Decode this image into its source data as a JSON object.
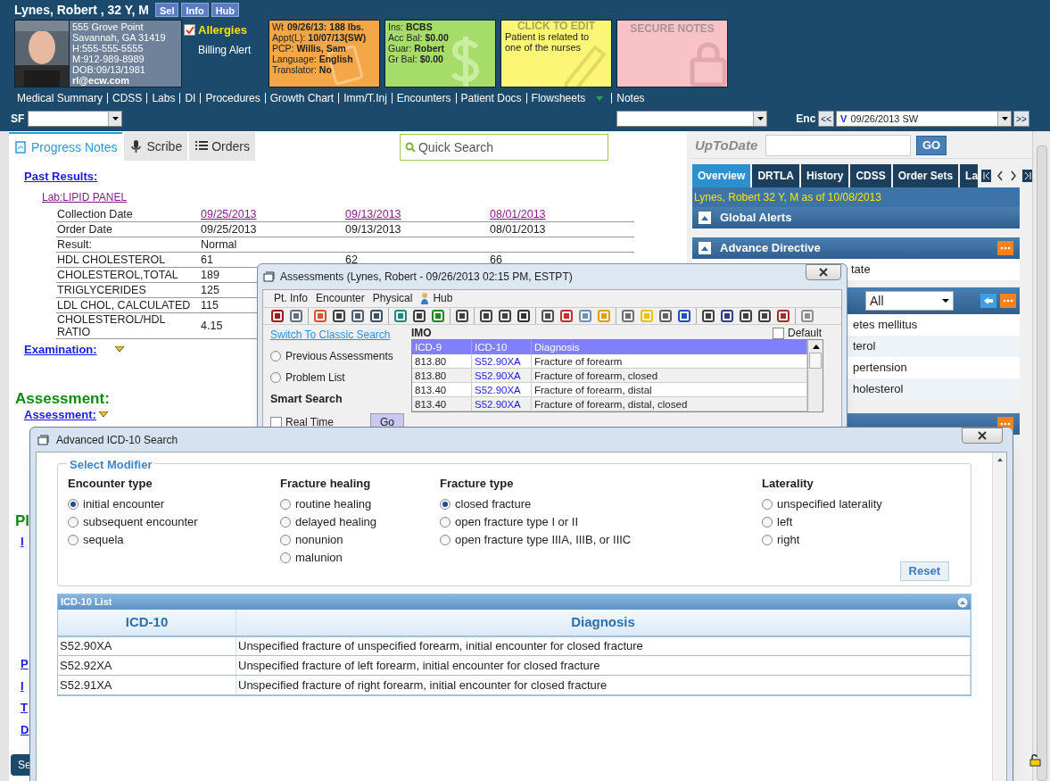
{
  "patient_header": {
    "name": "Lynes, Robert , 32 Y, M",
    "buttons": [
      "Sel",
      "Info",
      "Hub"
    ],
    "address_lines": [
      "555 Grove Point",
      "Savannah, GA 31419",
      "H:555-555-5555",
      "M:912-989-8989",
      "DOB:09/13/1981",
      "rl@ecw.com"
    ],
    "allergies": {
      "label": "Allergies",
      "checked": true
    },
    "billing_alert": "Billing Alert",
    "visit_card": [
      {
        "label": "Wt",
        "value": "09/26/13: 188 lbs."
      },
      {
        "label": "Appt(L):",
        "value": "10/07/13(SW)"
      },
      {
        "label": "PCP:",
        "value": "Willis, Sam"
      },
      {
        "label": "Language:",
        "value": "English"
      },
      {
        "label": "Translator:",
        "value": "No"
      }
    ],
    "insurance_card": [
      {
        "label": "Ins:",
        "value": "BCBS"
      },
      {
        "label": "Acc Bal:",
        "value": "$0.00"
      },
      {
        "label": "Guar:",
        "value": "Robert"
      },
      {
        "label": "Gr Bal:",
        "value": "$0.00"
      }
    ],
    "notes_card": {
      "title": "CLICK TO EDIT",
      "text": "Patient is related to one of the nurses"
    },
    "secure_notes": {
      "title": "SECURE NOTES"
    }
  },
  "nav_links": [
    {
      "label": "Medical Summary",
      "has_menu": false
    },
    {
      "label": "CDSS",
      "has_menu": false
    },
    {
      "label": "Labs",
      "has_menu": false
    },
    {
      "label": "DI",
      "has_menu": false
    },
    {
      "label": "Procedures",
      "has_menu": false
    },
    {
      "label": "Growth Chart",
      "has_menu": false
    },
    {
      "label": "Imm/T.Inj",
      "has_menu": false
    },
    {
      "label": "Encounters",
      "has_menu": false
    },
    {
      "label": "Patient Docs",
      "has_menu": false
    },
    {
      "label": "Flowsheets",
      "has_menu": true
    },
    {
      "label": "Notes",
      "has_menu": false
    }
  ],
  "toolbar": {
    "sf_label": "SF",
    "enc_label": "Enc",
    "enc_prev": "<<",
    "enc_next": ">>",
    "enc_marker": "V",
    "encounter": "09/26/2013 SW"
  },
  "left_panel": {
    "tabs": [
      {
        "label": "Progress Notes",
        "selected": true
      },
      {
        "label": "Scribe",
        "selected": false
      },
      {
        "label": "Orders",
        "selected": false
      }
    ],
    "quick_search": {
      "placeholder": "Quick Search"
    },
    "past_results": "Past Results:",
    "lab": "Lab:LIPID PANEL",
    "results_rows": [
      {
        "kind": "link",
        "cells": [
          "Collection Date",
          "09/25/2013",
          "09/13/2013",
          "08/01/2013"
        ]
      },
      {
        "kind": "plain",
        "cells": [
          "Order Date",
          "09/25/2013",
          "09/13/2013",
          "08/01/2013"
        ]
      },
      {
        "kind": "plain",
        "cells": [
          "Result:",
          "Normal"
        ]
      },
      {
        "kind": "plain",
        "cells": [
          "HDL CHOLESTEROL",
          "61",
          "62",
          "66"
        ]
      },
      {
        "kind": "plain",
        "cells": [
          "CHOLESTEROL,TOTAL",
          "189"
        ]
      },
      {
        "kind": "plain",
        "cells": [
          "TRIGLYCERIDES",
          "125"
        ]
      },
      {
        "kind": "plain",
        "cells": [
          "LDL CHOL, CALCULATED",
          "115"
        ]
      },
      {
        "kind": "plain",
        "cells": [
          "CHOLESTEROL/HDL RATIO",
          "4.15"
        ]
      }
    ],
    "examination": "Examination:",
    "assessment_heading": "Assessment:",
    "assessment_link": "Assessment:",
    "plan_fragment": "Pl",
    "link_fragments": [
      "I",
      "P",
      "I",
      "T",
      "D"
    ],
    "bottom_button": "Se"
  },
  "right_panel": {
    "label": "UpToDate",
    "go": "GO",
    "tabs": [
      {
        "label": "Overview",
        "selected": true
      },
      {
        "label": "DRTLA",
        "selected": false
      },
      {
        "label": "History",
        "selected": false
      },
      {
        "label": "CDSS",
        "selected": false
      },
      {
        "label": "Order Sets",
        "selected": false
      },
      {
        "label": "La",
        "selected": false
      }
    ],
    "patient_line": "Lynes, Robert 32 Y, M as of 10/08/2013",
    "global_alerts": "Global Alerts",
    "advance_directive": "Advance Directive",
    "directive_text": "tate",
    "filter": "All",
    "problems": [
      "etes mellitus",
      "terol",
      "pertension",
      "holesterol"
    ]
  },
  "assessments_window": {
    "title": "Assessments (Lynes, Robert  - 09/26/2013  02:15 PM, ESTPT)",
    "menu": [
      "Pt. Info",
      "Encounter",
      "Physical",
      "Hub"
    ],
    "classic_search": "Switch To Classic Search",
    "sources": [
      {
        "label": "Previous Assessments",
        "selected": false
      },
      {
        "label": "Problem List",
        "selected": false
      }
    ],
    "smart_search": "Smart Search",
    "real_time": {
      "label": "Real Time",
      "checked": false
    },
    "go": "Go",
    "imo": "IMO",
    "default": {
      "label": "Default",
      "checked": false
    },
    "columns": [
      "ICD-9",
      "ICD-10",
      "Diagnosis"
    ],
    "rows": [
      [
        "813.80",
        "S52.90XA",
        "Fracture of forearm"
      ],
      [
        "813.80",
        "S52.90XA",
        "Fracture of forearm, closed"
      ],
      [
        "813.40",
        "S52.90XA",
        "Fracture of forearm, distal"
      ],
      [
        "813.40",
        "S52.90XA",
        "Fracture of forearm, distal, closed"
      ]
    ]
  },
  "icd_window": {
    "title": "Advanced ICD-10 Search",
    "legend": "Select Modifier",
    "groups": [
      {
        "title": "Encounter type",
        "options": [
          {
            "label": "initial encounter",
            "selected": true
          },
          {
            "label": "subsequent encounter",
            "selected": false
          },
          {
            "label": "sequela",
            "selected": false
          }
        ]
      },
      {
        "title": "Fracture healing",
        "options": [
          {
            "label": "routine healing",
            "selected": false
          },
          {
            "label": "delayed healing",
            "selected": false
          },
          {
            "label": "nonunion",
            "selected": false
          },
          {
            "label": "malunion",
            "selected": false
          }
        ]
      },
      {
        "title": "Fracture type",
        "options": [
          {
            "label": "closed fracture",
            "selected": true
          },
          {
            "label": "open fracture type I or II",
            "selected": false
          },
          {
            "label": "open fracture type IIIA, IIIB, or IIIC",
            "selected": false
          }
        ]
      },
      {
        "title": "Laterality",
        "options": [
          {
            "label": "unspecified laterality",
            "selected": false
          },
          {
            "label": "left",
            "selected": false
          },
          {
            "label": "right",
            "selected": false
          }
        ]
      }
    ],
    "reset": "Reset",
    "list_title": "ICD-10 List",
    "columns": [
      "ICD-10",
      "Diagnosis"
    ],
    "rows": [
      [
        "S52.90XA",
        "Unspecified fracture of unspecified forearm, initial encounter for closed fracture"
      ],
      [
        "S52.92XA",
        "Unspecified fracture of left forearm, initial encounter for closed fracture"
      ],
      [
        "S52.91XA",
        "Unspecified fracture of right forearm, initial encounter for closed fracture"
      ]
    ]
  }
}
